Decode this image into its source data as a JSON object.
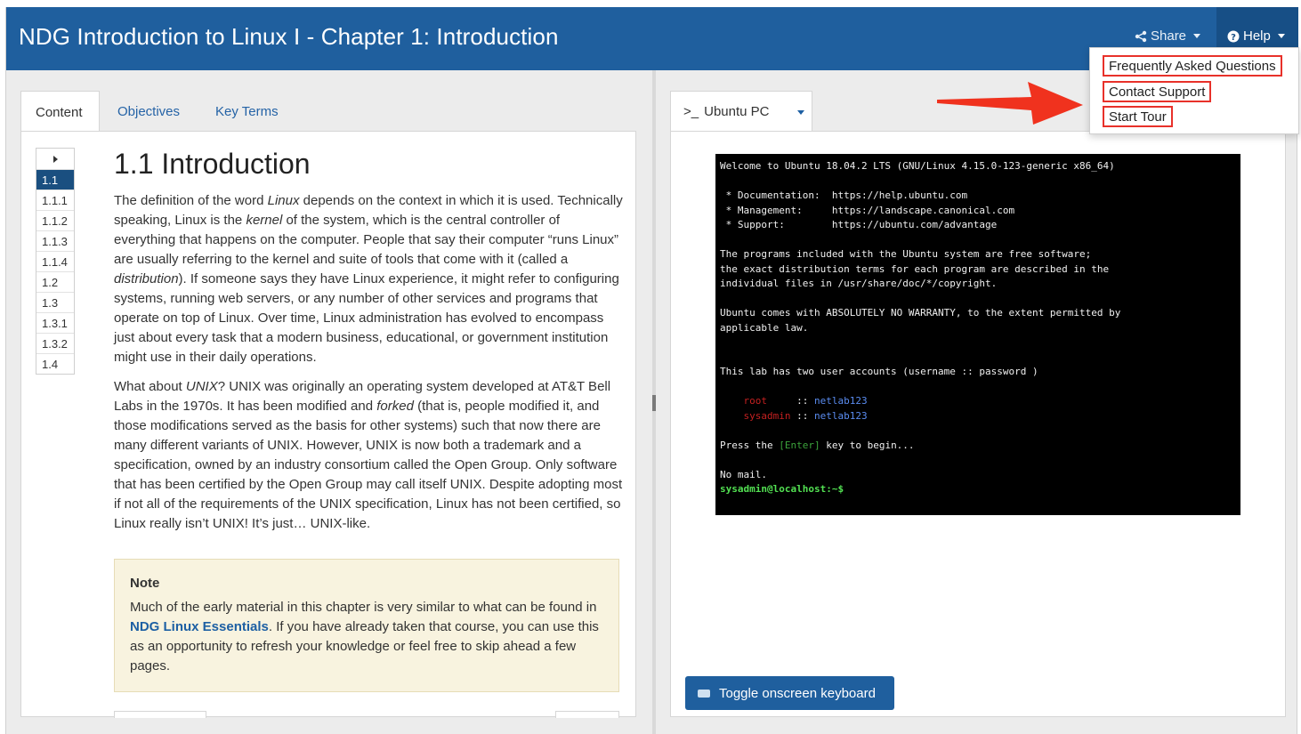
{
  "header": {
    "title": "NDG Introduction to Linux I - Chapter 1: Introduction",
    "share_label": "Share",
    "help_label": "Help"
  },
  "help_menu": {
    "items": [
      "Frequently Asked Questions",
      "Contact Support",
      "Start Tour"
    ],
    "highlight_color": "#e8312a"
  },
  "tabs": [
    {
      "label": "Content",
      "active": true
    },
    {
      "label": "Objectives",
      "active": false
    },
    {
      "label": "Key Terms",
      "active": false
    }
  ],
  "toc": [
    "1.1",
    "1.1.1",
    "1.1.2",
    "1.1.3",
    "1.1.4",
    "1.2",
    "1.3",
    "1.3.1",
    "1.3.2",
    "1.4"
  ],
  "article": {
    "heading": "1.1 Introduction"
  },
  "note": {
    "title": "Note",
    "text_before": "Much of the early material in this chapter is very similar to what can be found in ",
    "link": "NDG Linux Essentials",
    "text_after": ". If you have already taken that course, you can use this as an opportunity to refresh your knowledge or feel free to skip ahead a few pages."
  },
  "terminal_tab": {
    "prompt_glyph": ">_",
    "label": "Ubuntu PC"
  },
  "terminal": {
    "welcome": "Welcome to Ubuntu 18.04.2 LTS (GNU/Linux 4.15.0-123-generic x86_64)",
    "links": [
      " * Documentation:  https://help.ubuntu.com",
      " * Management:     https://landscape.canonical.com",
      " * Support:        https://ubuntu.com/advantage"
    ],
    "license": [
      "The programs included with the Ubuntu system are free software;",
      "the exact distribution terms for each program are described in the",
      "individual files in /usr/share/doc/*/copyright."
    ],
    "warranty": [
      "Ubuntu comes with ABSOLUTELY NO WARRANTY, to the extent permitted by",
      "applicable law."
    ],
    "accounts_line": "This lab has two user accounts (username :: password )",
    "user1": "root",
    "user2": "sysadmin",
    "sep": "::",
    "password": "netlab123",
    "press_prefix": "Press the ",
    "enter_key": "[Enter]",
    "press_suffix": " key to begin...",
    "no_mail": "No mail.",
    "prompt": "sysadmin@localhost:~$"
  },
  "keyboard_button": "Toggle onscreen keyboard",
  "colors": {
    "header_bg": "#1f5f9e",
    "help_bg": "#174f86",
    "toc_active": "#1a4f80",
    "note_bg": "#f8f3df",
    "arrow": "#f0321e"
  }
}
